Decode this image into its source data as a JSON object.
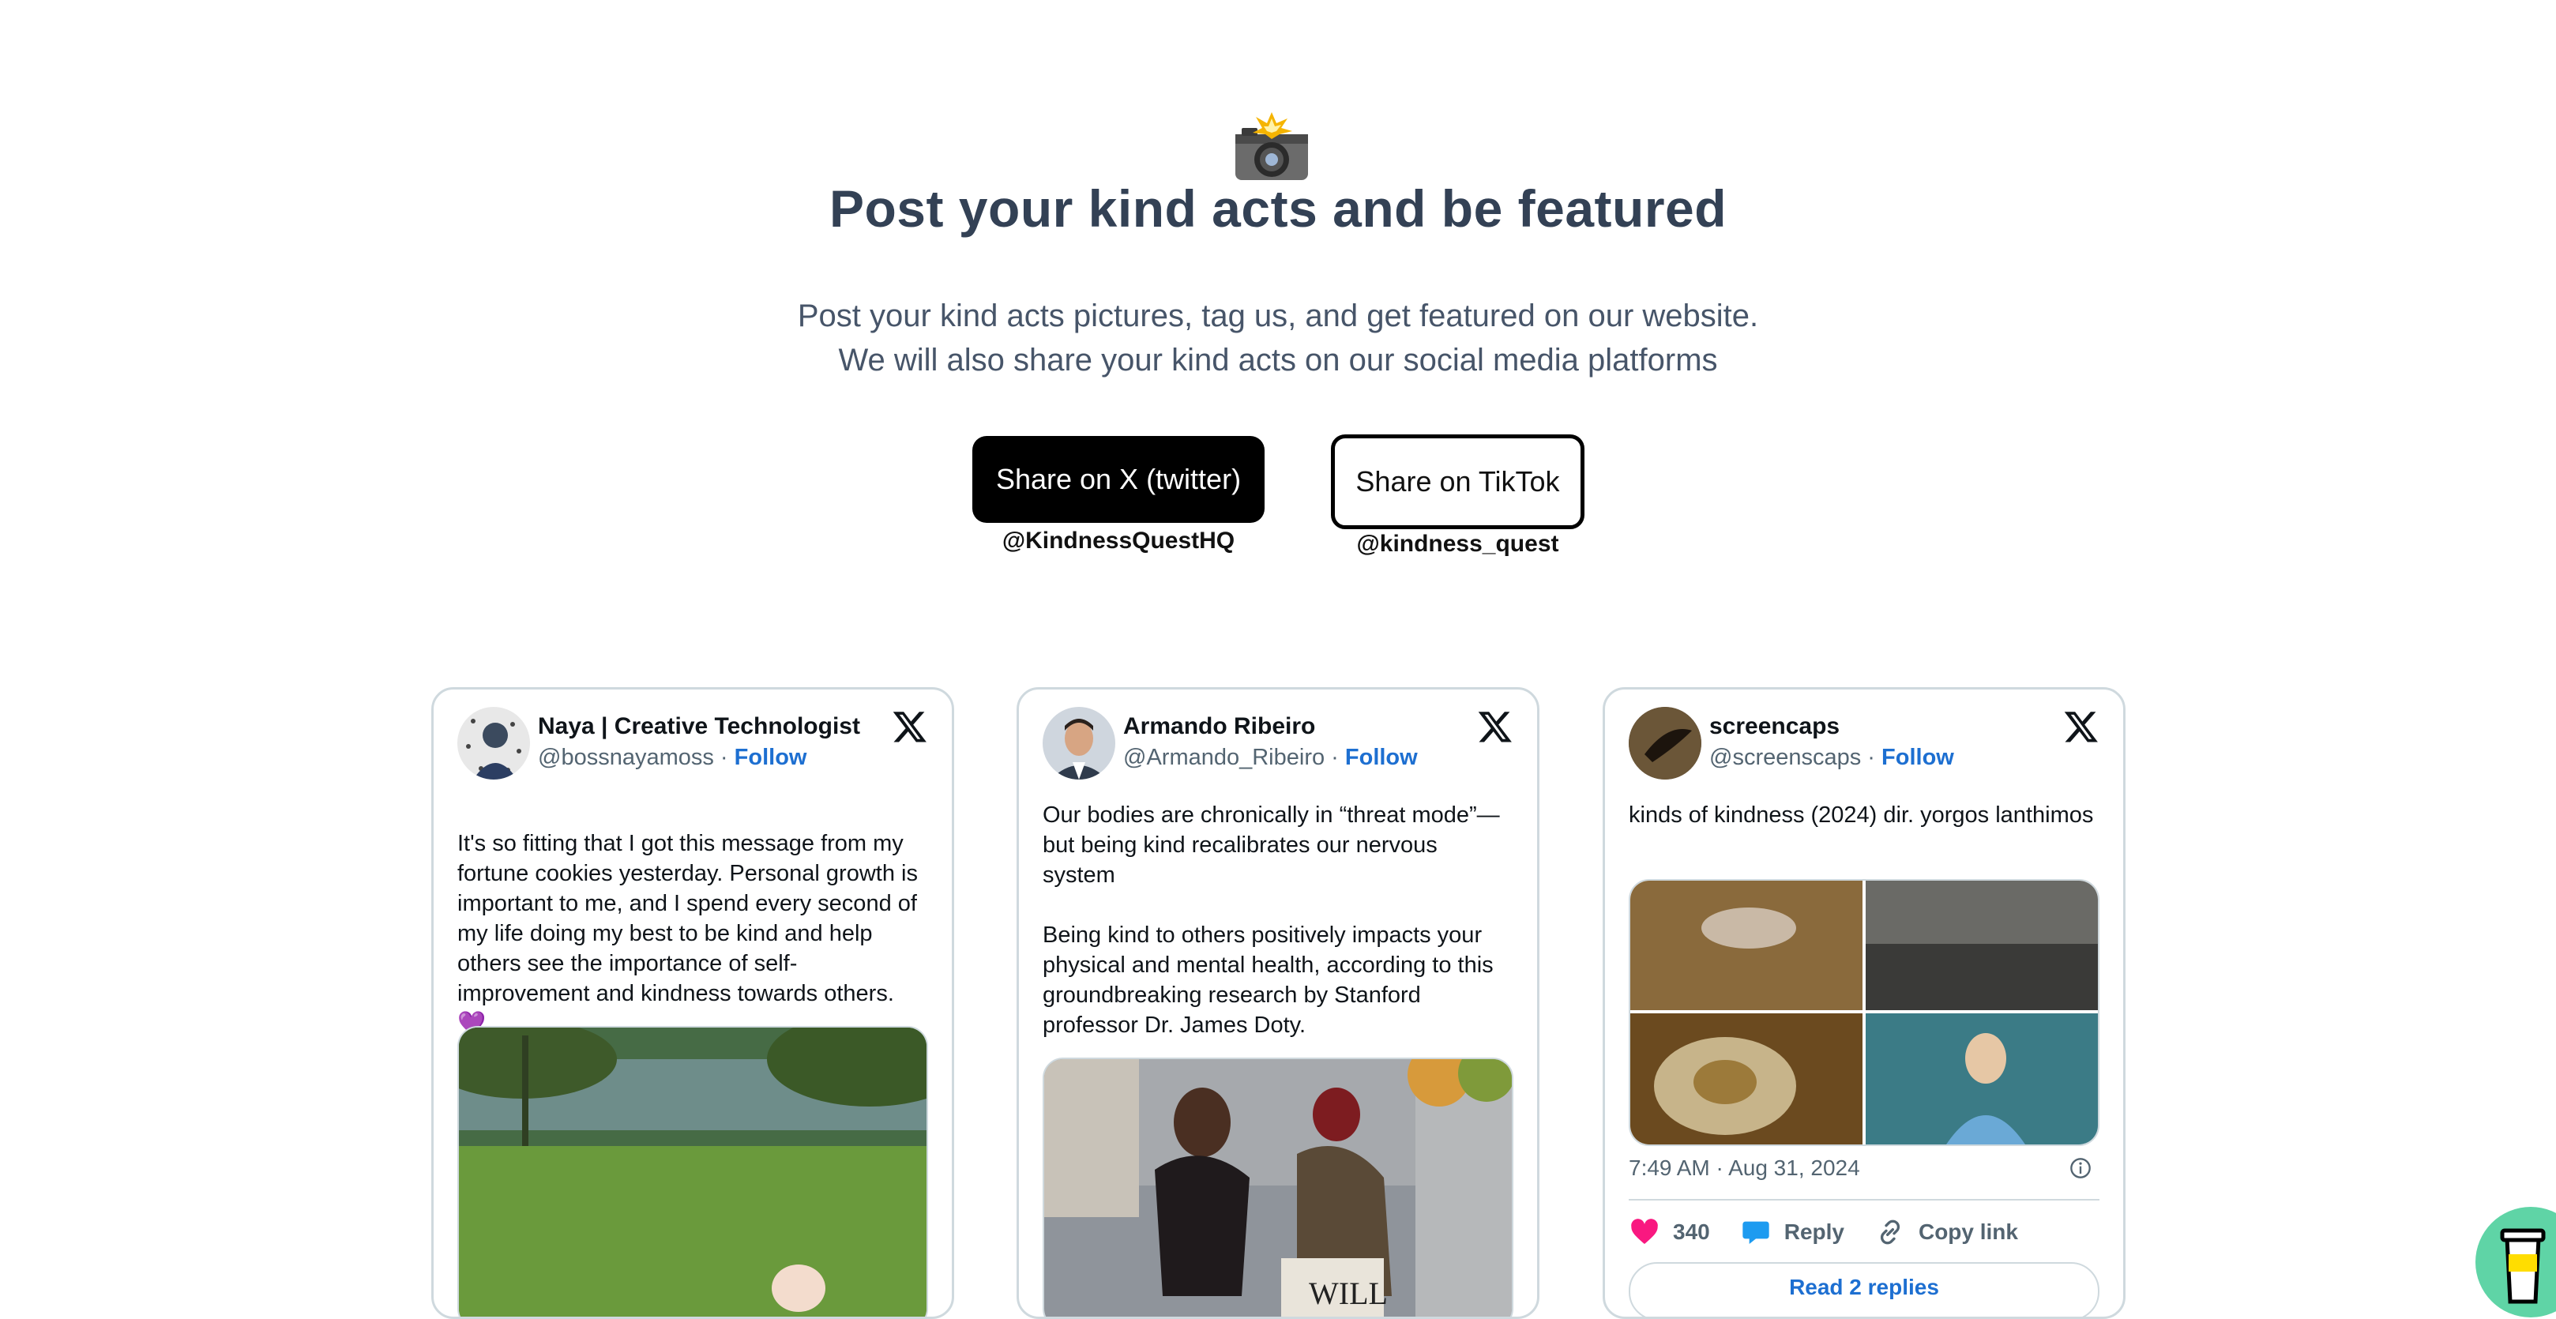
{
  "hero": {
    "icon": "camera-flash-icon",
    "title": "Post your kind acts and be featured",
    "subtitle_line1": "Post your kind acts pictures, tag us, and get featured on our website.",
    "subtitle_line2": "We will also share your kind acts on our social media platforms",
    "share_x_label": "Share on X (twitter)",
    "share_x_handle": "@KindnessQuestHQ",
    "share_tiktok_label": "Share on TikTok",
    "share_tiktok_handle": "@kindness_quest"
  },
  "tweets": [
    {
      "name": "Naya | Creative Technologist",
      "handle": "@bossnayamoss",
      "follow": "Follow",
      "text": "It's so fitting that I got this message from my fortune cookies yesterday. Personal growth is important to me, and I spend every second of my life doing my best to be kind and help others see the importance of self-improvement and kindness towards others.",
      "emoji": "💜"
    },
    {
      "name": "Armando Ribeiro",
      "handle": "@Armando_Ribeiro",
      "follow": "Follow",
      "text": "Our bodies are chronically in “threat mode”—but being kind recalibrates our nervous system\n\nBeing kind to others positively impacts your physical and mental health, according to this groundbreaking research by Stanford professor Dr. James Doty.",
      "image_sign_text": "WILL"
    },
    {
      "name": "screencaps",
      "handle": "@screenscaps",
      "follow": "Follow",
      "text": "kinds of kindness (2024) dir. yorgos lanthimos",
      "timestamp": "7:49 AM · Aug 31, 2024",
      "likes": "340",
      "reply_label": "Reply",
      "copy_label": "Copy link",
      "read_replies_label": "Read 2 replies"
    }
  ],
  "colors": {
    "title": "#334155",
    "follow_link": "#1d6fd1",
    "border": "#cfd9de",
    "heart": "#f91880",
    "reply": "#1d9bf0",
    "bmc_button": "#5fd4a6"
  }
}
